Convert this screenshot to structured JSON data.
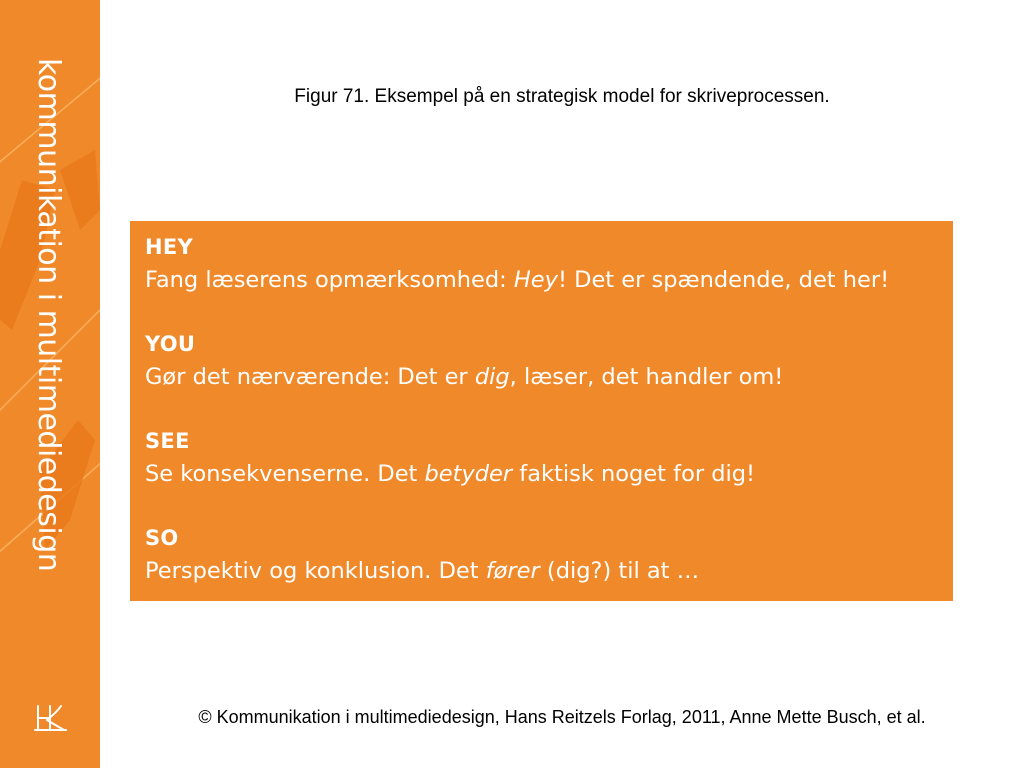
{
  "sidebar": {
    "title": "kommunikation i multimediedesign",
    "logo_text": "HR",
    "background_color": "#f0892a"
  },
  "caption": "Figur 71. Eksempel på en strategisk model for skriveprocessen.",
  "model": {
    "background_color": "#f0892a",
    "steps": [
      {
        "heading": "HEY",
        "text_before": "Fang læserens opmærksomhed: ",
        "text_emphasis": "Hey",
        "text_after": "! Det er spændende, det her!"
      },
      {
        "heading": "YOU",
        "text_before": "Gør det nærværende: Det er ",
        "text_emphasis": "dig",
        "text_after": ", læser, det handler om!"
      },
      {
        "heading": "SEE",
        "text_before": "Se konsekvenserne. Det ",
        "text_emphasis": "betyder",
        "text_after": " faktisk noget for dig!"
      },
      {
        "heading": "SO",
        "text_before": "Perspektiv og konklusion. Det ",
        "text_emphasis": "fører",
        "text_after": " (dig?) til at …"
      }
    ]
  },
  "footer": "© Kommunikation i multimediedesign, Hans Reitzels Forlag, 2011, Anne Mette Busch, et al."
}
